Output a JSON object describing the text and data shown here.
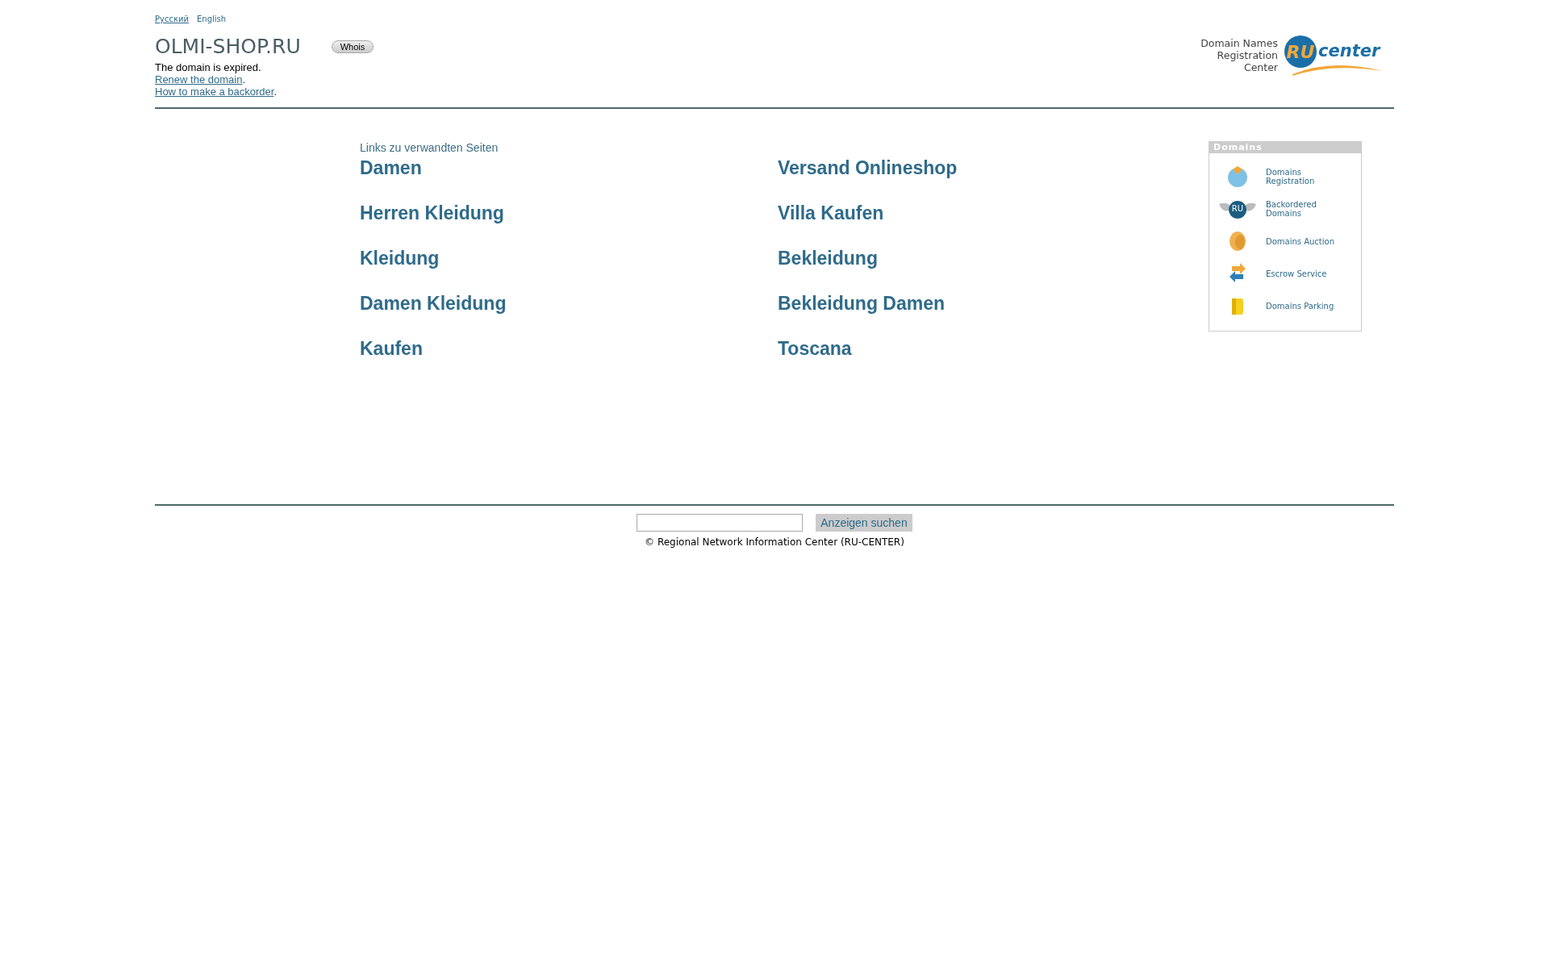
{
  "languages": [
    {
      "label": "Русский",
      "selected": false
    },
    {
      "label": "English",
      "selected": true
    }
  ],
  "domain": {
    "name": "OLMI-SHOP.RU",
    "whois_button": "Whois",
    "status": "The domain is expired.",
    "links": [
      {
        "label": "Renew the domain",
        "end": "."
      },
      {
        "label": "How to make a backorder",
        "end": "."
      }
    ]
  },
  "registrar": {
    "caption": [
      "Domain Names",
      "Registration",
      "Center"
    ],
    "logo_mark": "RU",
    "logo_word": "center"
  },
  "related": {
    "heading": "Links zu verwandten Seiten",
    "links": [
      "Damen",
      "Versand Onlineshop",
      "Herren Kleidung",
      "Villa Kaufen",
      "Kleidung",
      "Bekleidung",
      "Damen Kleidung",
      "Bekleidung Damen",
      "Kaufen",
      "Toscana"
    ]
  },
  "sidebar": {
    "title": "Domains",
    "items": [
      {
        "kind": "globe",
        "label": "Domains Registration"
      },
      {
        "kind": "wings",
        "label": "Backordered Domains",
        "badge": "RU"
      },
      {
        "kind": "coin",
        "label": "Domains Auction"
      },
      {
        "kind": "arrows",
        "label": "Escrow Service"
      },
      {
        "kind": "stack",
        "label": "Domains Parking"
      }
    ]
  },
  "search": {
    "button": "Anzeigen suchen"
  },
  "footer": {
    "copyright": "© Regional Network Information Center (RU-CENTER)"
  }
}
